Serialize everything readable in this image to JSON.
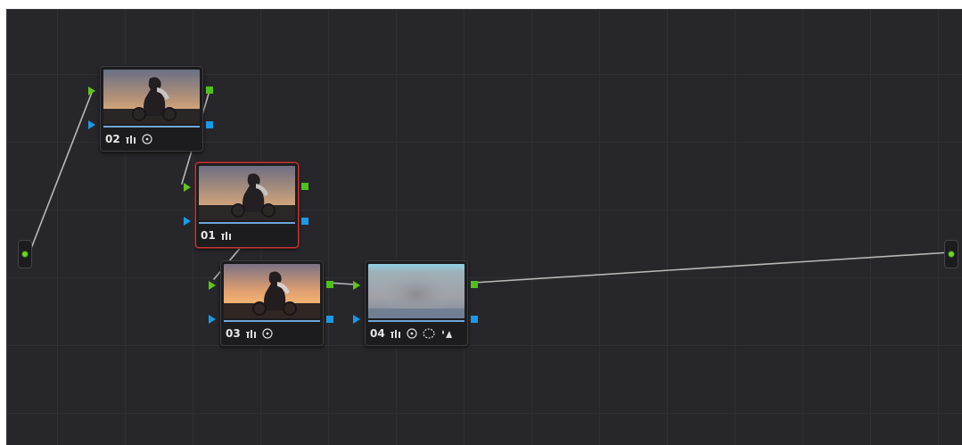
{
  "nodes": [
    {
      "id": "02",
      "label": "02",
      "icons": [
        "levels-icon",
        "circle-window-icon"
      ],
      "selected": false
    },
    {
      "id": "01",
      "label": "01",
      "icons": [
        "levels-icon"
      ],
      "selected": true
    },
    {
      "id": "03",
      "label": "03",
      "icons": [
        "levels-icon",
        "circle-window-icon"
      ],
      "selected": false
    },
    {
      "id": "04",
      "label": "04",
      "icons": [
        "levels-icon",
        "circle-window-icon",
        "dotted-window-icon",
        "qualifier-icon"
      ],
      "selected": false
    }
  ],
  "colors": {
    "background": "#27272b",
    "rgb_port": "#4fbf1e",
    "key_port": "#1e98e6",
    "selected_border": "#c33b35",
    "wire": "#b5b5b5"
  }
}
